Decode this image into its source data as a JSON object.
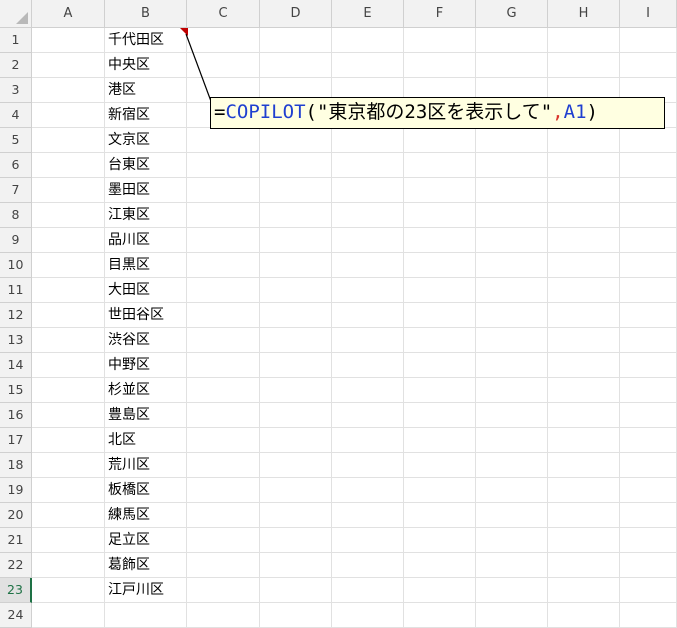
{
  "columns": [
    "A",
    "B",
    "C",
    "D",
    "E",
    "F",
    "G",
    "H",
    "I"
  ],
  "rows": [
    "1",
    "2",
    "3",
    "4",
    "5",
    "6",
    "7",
    "8",
    "9",
    "10",
    "11",
    "12",
    "13",
    "14",
    "15",
    "16",
    "17",
    "18",
    "19",
    "20",
    "21",
    "22",
    "23",
    "24"
  ],
  "active_row": "23",
  "column_b_values": [
    "千代田区",
    "中央区",
    "港区",
    "新宿区",
    "文京区",
    "台東区",
    "墨田区",
    "江東区",
    "品川区",
    "目黒区",
    "大田区",
    "世田谷区",
    "渋谷区",
    "中野区",
    "杉並区",
    "豊島区",
    "北区",
    "荒川区",
    "板橋区",
    "練馬区",
    "足立区",
    "葛飾区",
    "江戸川区"
  ],
  "callout": {
    "eq": "=",
    "fn": "COPILOT",
    "open": "(",
    "string": "\"東京都の23区を表示して\"",
    "comma": ",",
    "ref": "A1",
    "close": ")"
  },
  "colors": {
    "function": "#1f3fd0",
    "comma": "#d9342b",
    "comment_marker": "#c00000",
    "callout_bg": "#ffffe1",
    "active_row_accent": "#1e7145"
  }
}
